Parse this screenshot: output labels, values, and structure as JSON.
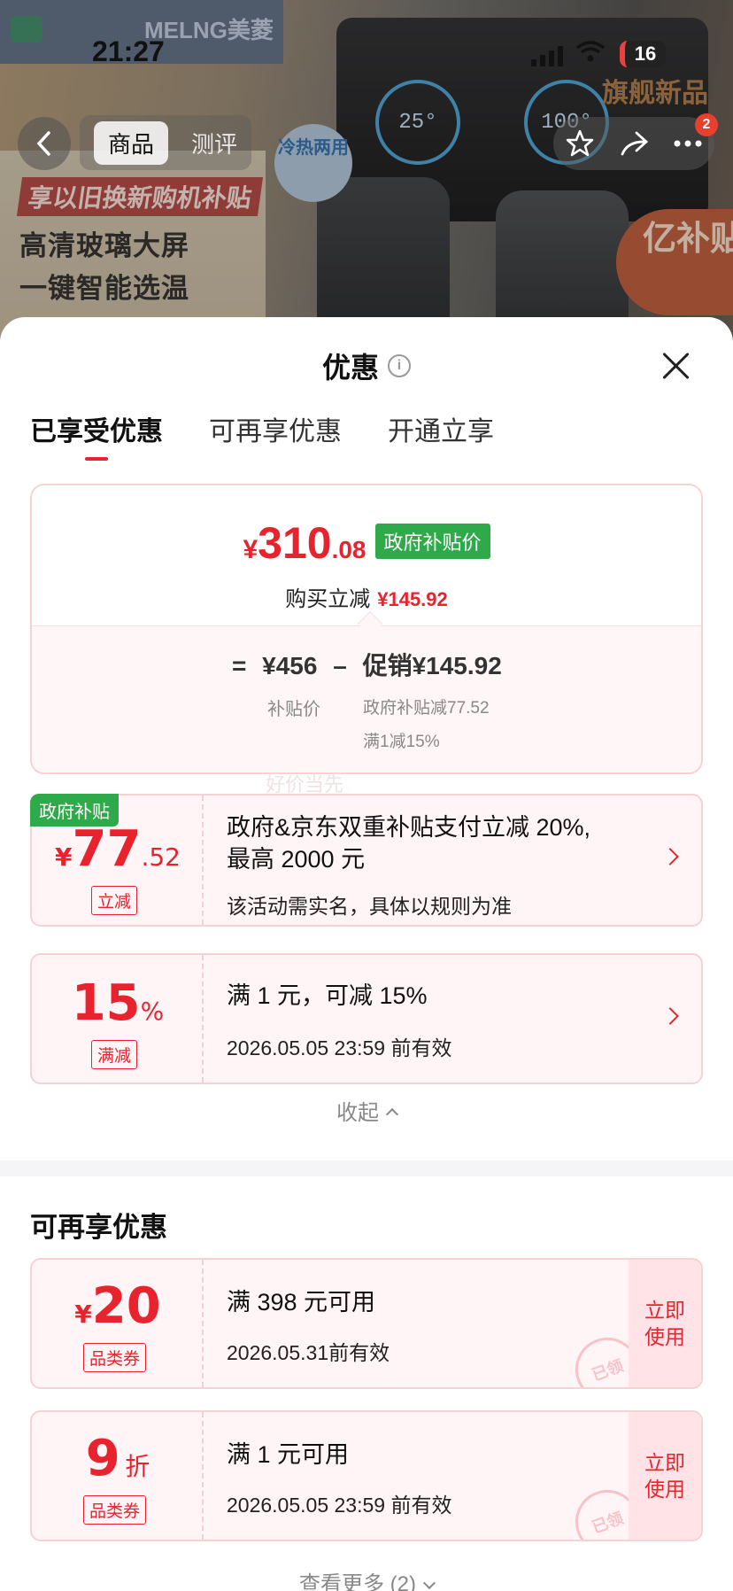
{
  "status_bar": {
    "time": "21:27",
    "battery": "16"
  },
  "product_header": {
    "brand": "MELNG美菱",
    "banner_lines": [
      "享以旧换新购机补贴",
      "高清玻璃大屏",
      "一键智能选温"
    ],
    "badge_cold_hot": "冷热两用",
    "badge_subsidy": "亿补贴",
    "badge_new": "旗舰新品",
    "dial_left": "25°",
    "dial_right": "100°",
    "cart_count": "2"
  },
  "nav": {
    "tabs": [
      "商品",
      "测评"
    ],
    "active_tab": "商品"
  },
  "sheet": {
    "title": "优惠",
    "close_icon": "close-icon",
    "tabs": [
      "已享受优惠",
      "可再享优惠",
      "开通立享"
    ],
    "active_tab_index": 0
  },
  "summary": {
    "currency": "¥",
    "price_int": "310",
    "price_dec": ".08",
    "price_tag": "政府补贴价",
    "instant_cut_label": "购买立减",
    "instant_cut_value": "¥145.92",
    "equals": "=",
    "base_price": "¥456",
    "minus": "–",
    "promo": "促销¥145.92",
    "base_price_label": "补贴价",
    "detail_1": "政府补贴减77.52",
    "detail_2": "满1减15%",
    "watermark": "好价当先"
  },
  "enjoyed": [
    {
      "corner_tag": "政府补贴",
      "cur": "¥",
      "amount_int": "77",
      "amount_dec": ".52",
      "kind": "立减",
      "title_1": "政府&京东双重补贴支付立减 20%,",
      "title_2": "最高 2000 元",
      "desc": "该活动需实名，具体以规则为准"
    },
    {
      "amount_int": "15",
      "unit": "%",
      "kind": "满减",
      "title_1": "满 1 元，可减 15%",
      "desc": "2026.05.05 23:59 前有效"
    }
  ],
  "collapse_label": "收起",
  "more_section": {
    "title": "可再享优惠",
    "coupons": [
      {
        "cur": "¥",
        "amount": "20",
        "kind": "品类券",
        "title": "满 398 元可用",
        "desc": "2026.05.31前有效",
        "button": "立即使用",
        "stamp": "已领"
      },
      {
        "amount": "9",
        "unit": "折",
        "kind": "品类券",
        "title": "满 1 元可用",
        "desc": "2026.05.05 23:59 前有效",
        "button": "立即使用",
        "stamp": "已领"
      }
    ],
    "see_more": "查看更多 (2)"
  },
  "colors": {
    "accent_red": "#e8232e",
    "gov_green": "#2faa4a",
    "card_border": "#f7d2d5",
    "card_bg": "#fff5f6"
  }
}
